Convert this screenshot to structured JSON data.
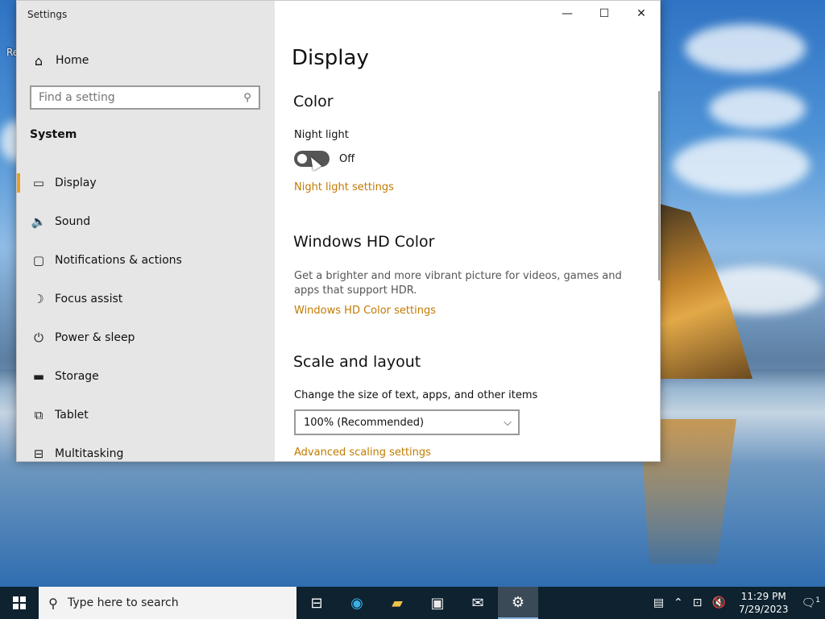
{
  "window": {
    "title": "Settings",
    "buttons": {
      "minimize": "—",
      "maximize": "☐",
      "close": "✕"
    }
  },
  "desktop": {
    "label": "Re"
  },
  "sidebar": {
    "home_label": "Home",
    "search_placeholder": "Find a setting",
    "section_title": "System",
    "items": [
      {
        "label": "Display",
        "icon": "monitor-icon",
        "glyph": "▭",
        "active": true
      },
      {
        "label": "Sound",
        "icon": "speaker-icon",
        "glyph": "🔈"
      },
      {
        "label": "Notifications & actions",
        "icon": "message-icon",
        "glyph": "▢"
      },
      {
        "label": "Focus assist",
        "icon": "moon-icon",
        "glyph": "☽"
      },
      {
        "label": "Power & sleep",
        "icon": "power-icon",
        "glyph": "⏻"
      },
      {
        "label": "Storage",
        "icon": "storage-icon",
        "glyph": "▬"
      },
      {
        "label": "Tablet",
        "icon": "tablet-icon",
        "glyph": "⧉"
      },
      {
        "label": "Multitasking",
        "icon": "multitasking-icon",
        "glyph": "⊟"
      }
    ]
  },
  "main": {
    "title": "Display",
    "color_heading": "Color",
    "night_light_label": "Night light",
    "night_light_state": "Off",
    "night_light_link": "Night light settings",
    "hdr_heading": "Windows HD Color",
    "hdr_desc": "Get a brighter and more vibrant picture for videos, games and apps that support HDR.",
    "hdr_link": "Windows HD Color settings",
    "scale_heading": "Scale and layout",
    "scale_label": "Change the size of text, apps, and other items",
    "scale_value": "100% (Recommended)",
    "advanced_link": "Advanced scaling settings"
  },
  "taskbar": {
    "search_placeholder": "Type here to search",
    "apps": [
      "task-view-icon",
      "edge-icon",
      "file-explorer-icon",
      "store-icon",
      "mail-icon",
      "settings-icon"
    ],
    "time": "11:29 PM",
    "date": "7/29/2023",
    "notification_count": "1"
  },
  "colors": {
    "accent": "#c27a00",
    "taskbar": "#0e2230",
    "sidebar": "#e6e6e6"
  }
}
